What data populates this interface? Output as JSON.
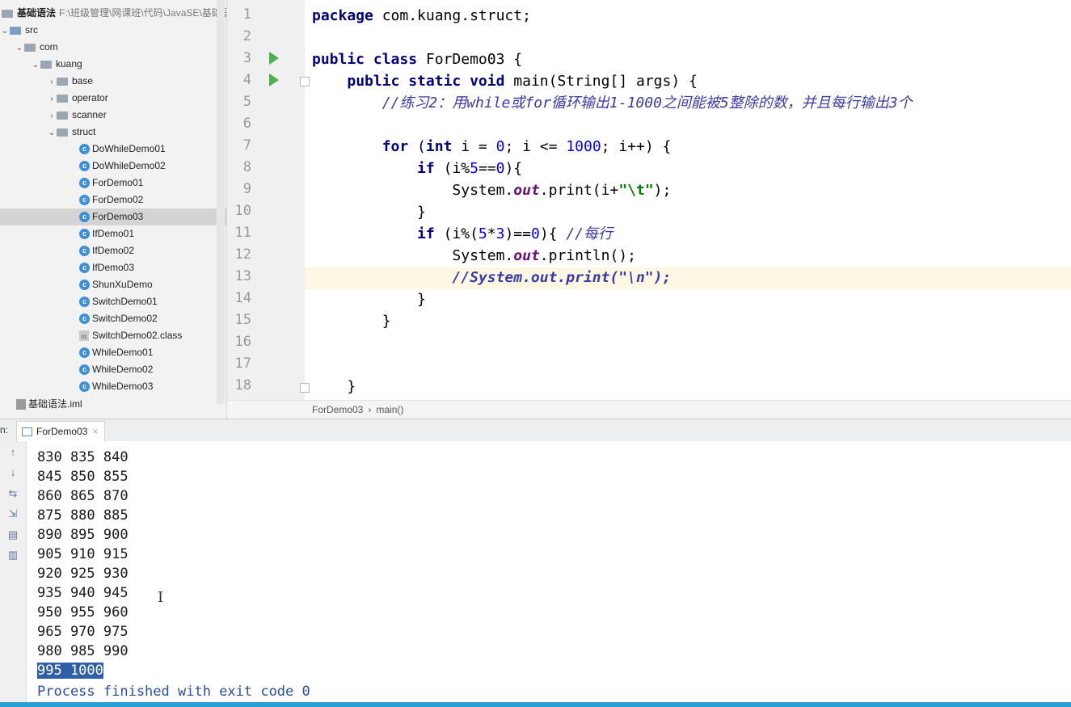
{
  "project": {
    "root_label": "基础语法",
    "root_path": "F:\\班级管理\\网课班\\代码\\JavaSE\\基础语",
    "src": "src",
    "com": "com",
    "kuang": "kuang",
    "folders": [
      "base",
      "operator",
      "scanner",
      "struct"
    ],
    "files": [
      "DoWhileDemo01",
      "DoWhileDemo02",
      "ForDemo01",
      "ForDemo02",
      "ForDemo03",
      "IfDemo01",
      "IfDemo02",
      "IfDemo03",
      "ShunXuDemo",
      "SwitchDemo01",
      "SwitchDemo02",
      "SwitchDemo02.class",
      "WhileDemo01",
      "WhileDemo02",
      "WhileDemo03"
    ],
    "selected_file": "ForDemo03",
    "iml": "基础语法.iml"
  },
  "editor": {
    "line_numbers": [
      "1",
      "2",
      "3",
      "4",
      "5",
      "6",
      "7",
      "8",
      "9",
      "10",
      "11",
      "12",
      "13",
      "14",
      "15",
      "16",
      "17",
      "18"
    ],
    "comment_exercise": "//练习2：用while或for循环输出1-1000之间能被5整除的数，并且每行输出3个",
    "comment_each_row": "//每行",
    "comment_print_n": "//System.out.print(\"\\n\");",
    "highlighted_line": "13"
  },
  "breadcrumb": {
    "class_name": "ForDemo03",
    "method_name": "main()"
  },
  "run_panel": {
    "label": "n:",
    "tab_label": "ForDemo03",
    "close_glyph": "×",
    "output_lines": [
      "830 835 840",
      "845 850 855",
      "860 865 870",
      "875 880 885",
      "890 895 900",
      "905 910 915",
      "920 925 930",
      "935 940 945",
      "950 955 960",
      "965 970 975",
      "980 985 990"
    ],
    "selected_line": "995 1000",
    "process_message": "Process finished with exit code 0"
  }
}
